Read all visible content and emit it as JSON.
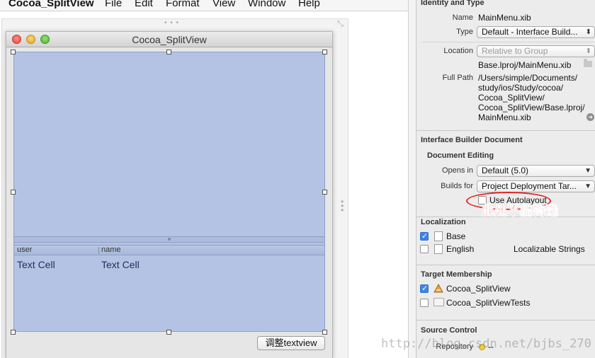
{
  "menubar": {
    "app": "Cocoa_SplitView",
    "items": [
      "File",
      "Edit",
      "Format",
      "View",
      "Window",
      "Help"
    ]
  },
  "window": {
    "title": "Cocoa_SplitView",
    "table": {
      "columns": [
        "user",
        "name"
      ],
      "cells": [
        "Text Cell",
        "Text Cell"
      ]
    },
    "adjust_button": "调整textview"
  },
  "inspector": {
    "identity": {
      "title": "Identity and Type",
      "name_label": "Name",
      "name_value": "MainMenu.xib",
      "type_label": "Type",
      "type_value": "Default - Interface Build...",
      "location_label": "Location",
      "location_value": "Relative to Group",
      "location_path": "Base.lproj/MainMenu.xib",
      "fullpath_label": "Full Path",
      "fullpath_lines": [
        "/Users/simple/Documents/",
        "study/ios/Study/cocoa/",
        "Cocoa_SplitView/",
        "Cocoa_SplitView/Base.lproj/",
        "MainMenu.xib"
      ]
    },
    "ib_document": {
      "title": "Interface Builder Document",
      "sub_title": "Document Editing",
      "opens_in_label": "Opens in",
      "opens_in_value": "Default (5.0)",
      "builds_for_label": "Builds for",
      "builds_for_value": "Project Deployment Tar...",
      "autolayout_label": "Use Autolayout"
    },
    "localization": {
      "title": "Localization",
      "items": [
        {
          "label": "Base",
          "checked": true
        },
        {
          "label": "English",
          "checked": false
        }
      ],
      "english_value": "Localizable Strings"
    },
    "target_membership": {
      "title": "Target Membership",
      "items": [
        {
          "label": "Cocoa_SplitView",
          "checked": true
        },
        {
          "label": "Cocoa_SplitViewTests",
          "checked": false
        }
      ]
    },
    "source_control": {
      "title": "Source Control",
      "repository_label": "Repository",
      "repository_value": "--"
    }
  },
  "annotation": {
    "text": "此处不能钩选",
    "color": "#e00000"
  },
  "watermark": "http://blog.csdn.net/bjbs_270"
}
